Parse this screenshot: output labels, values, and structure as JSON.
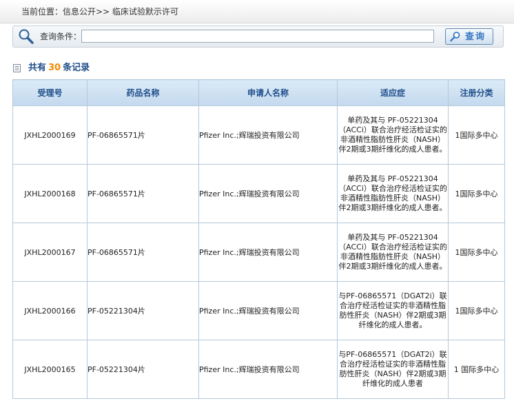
{
  "breadcrumb": "当前位置：信息公开>> 临床试验默示许可",
  "search": {
    "label": "查询条件：",
    "value": "",
    "button_label": "查询"
  },
  "summary": {
    "prefix": "共有",
    "count": "30",
    "suffix": "条记录"
  },
  "table": {
    "headers": [
      "受理号",
      "药品名称",
      "申请人名称",
      "适应症",
      "注册分类"
    ],
    "rows": [
      {
        "accept_no": "JXHL2000169",
        "drug": "PF-06865571片",
        "applicant": "Pfizer Inc.;辉瑞投资有限公司",
        "indication": "单药及其与 PF-05221304（ACCi）联合治疗经活检证实的非酒精性脂肪性肝炎（NASH）伴2期或3期纤维化的成人患者。",
        "category": "1国际多中心"
      },
      {
        "accept_no": "JXHL2000168",
        "drug": "PF-06865571片",
        "applicant": "Pfizer Inc.;辉瑞投资有限公司",
        "indication": "单药及其与 PF-05221304（ACCi）联合治疗经活检证实的非酒精性脂肪性肝炎（NASH）伴2期或3期纤维化的成人患者。",
        "category": "1国际多中心"
      },
      {
        "accept_no": "JXHL2000167",
        "drug": "PF-06865571片",
        "applicant": "Pfizer Inc.;辉瑞投资有限公司",
        "indication": "单药及其与 PF-05221304（ACCi）联合治疗经活检证实的非酒精性脂肪性肝炎（NASH）伴2期或3期纤维化的成人患者。",
        "category": "1国际多中心"
      },
      {
        "accept_no": "JXHL2000166",
        "drug": "PF-05221304片",
        "applicant": "Pfizer Inc.;辉瑞投资有限公司",
        "indication": "与PF-06865571（DGAT2i）联合治疗经活检证实的非酒精性脂肪性肝炎（NASH）伴2期或3期纤维化的成人患者。",
        "category": "1国际多中心"
      },
      {
        "accept_no": "JXHL2000165",
        "drug": "PF-05221304片",
        "applicant": "Pfizer Inc.;辉瑞投资有限公司",
        "indication": "与PF-06865571（DGAT2i）联合治疗经活检证实的非酒精性脂肪性肝炎（NASH）伴2期或3期纤维化的成人患者",
        "category": "1 国际多中心"
      }
    ]
  }
}
